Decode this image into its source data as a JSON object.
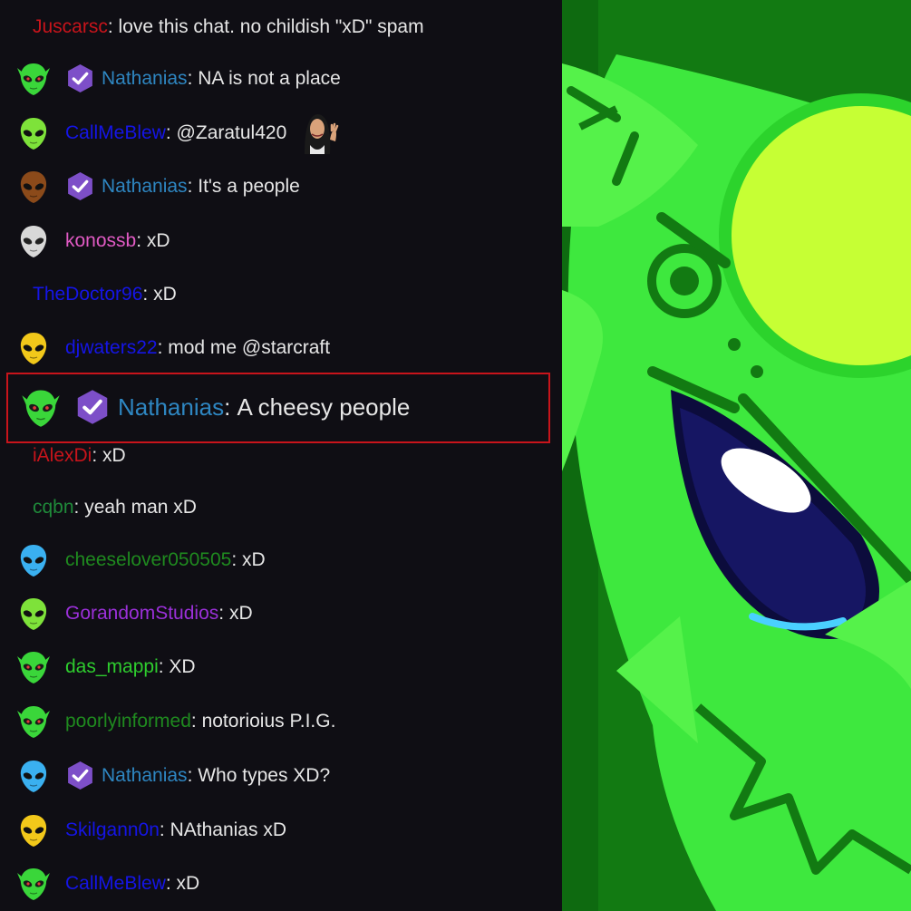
{
  "chat": {
    "messages": [
      {
        "username": "Juscarsc",
        "text": "love this chat. no childish \"xD\" spam",
        "name_color": "#c8141b",
        "avatar": "none",
        "badge": false
      },
      {
        "username": "Nathanias",
        "text": "NA is not a place",
        "name_color": "#2e86c1",
        "avatar": "green-goblin",
        "badge": true
      },
      {
        "username": "CallMeBlew",
        "text": "@Zaratul420",
        "name_color": "#1515e6",
        "avatar": "green-alien",
        "badge": false,
        "emote": "waving-woman-emote"
      },
      {
        "username": "Nathanias",
        "text": "It's a people",
        "name_color": "#2e86c1",
        "avatar": "brown-alien",
        "badge": true
      },
      {
        "username": "konossb",
        "text": "xD",
        "name_color": "#e05ac3",
        "avatar": "grey-alien",
        "badge": false
      },
      {
        "username": "TheDoctor96",
        "text": "xD",
        "name_color": "#1515e6",
        "avatar": "none",
        "badge": false
      },
      {
        "username": "djwaters22",
        "text": "mod me @starcraft",
        "name_color": "#1515e6",
        "avatar": "yellow-alien",
        "badge": false
      },
      {
        "username": "Nathanias",
        "text": "A cheesy people",
        "name_color": "#2e86c1",
        "avatar": "green-goblin",
        "badge": true,
        "highlighted": true
      },
      {
        "username": "iAlexDi",
        "text": "xD",
        "name_color": "#c8141b",
        "avatar": "none",
        "badge": false
      },
      {
        "username": "cqbn",
        "text": "yeah man xD",
        "name_color": "#1f8a3a",
        "avatar": "none",
        "badge": false
      },
      {
        "username": "cheeselover050505",
        "text": "xD",
        "name_color": "#1f8a1f",
        "avatar": "blue-alien",
        "badge": false
      },
      {
        "username": "GorandomStudios",
        "text": "xD",
        "name_color": "#9b30d9",
        "avatar": "green-alien",
        "badge": false
      },
      {
        "username": "das_mappi",
        "text": "XD",
        "name_color": "#2ecc2e",
        "avatar": "green-goblin",
        "badge": false
      },
      {
        "username": "poorlyinformed",
        "text": "notorioius P.I.G.",
        "name_color": "#1f8a1f",
        "avatar": "green-goblin-red",
        "badge": false
      },
      {
        "username": "Nathanias",
        "text": "Who types XD?",
        "name_color": "#2e86c1",
        "avatar": "blue-alien",
        "badge": true
      },
      {
        "username": "Skilgann0n",
        "text": "NAthanias xD",
        "name_color": "#1515e6",
        "avatar": "yellow-alien",
        "badge": false
      },
      {
        "username": "CallMeBlew",
        "text": "xD",
        "name_color": "#1515e6",
        "avatar": "green-goblin",
        "badge": false
      }
    ],
    "separator": ": "
  },
  "badge_icon": "verified-check-icon",
  "art": {
    "subject": "green-goblin-face-closeup",
    "colors": {
      "background": "#127a12",
      "skin": "#3ee83e",
      "eye": "#0c0c3c",
      "highlight": "#d8ff2a"
    }
  }
}
